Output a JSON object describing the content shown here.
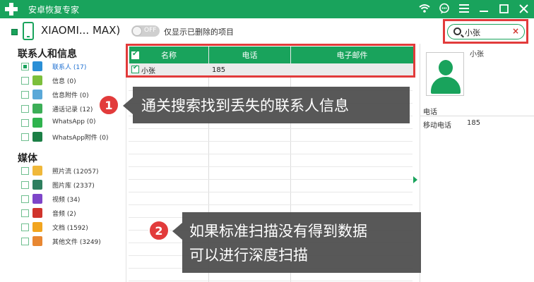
{
  "app": {
    "title": "安卓恢复专家",
    "brand_color": "#19a35c",
    "highlight_color": "#e23b3b"
  },
  "titlebar_icons": [
    "wifi-icon",
    "chat-icon",
    "menu-icon",
    "minimize-icon",
    "maximize-icon",
    "close-icon"
  ],
  "device": {
    "name": "XIAOMI... MAX)",
    "toggle_label": "OFF",
    "filter_label": "仅显示已删除的项目"
  },
  "search": {
    "value": "小张",
    "clear_glyph": "×"
  },
  "sidebar": {
    "contacts_title": "联系人和信息",
    "media_title": "媒体",
    "contact_items": [
      {
        "label": "联系人 (17)",
        "icon": "contacts-icon",
        "color": "#2b8fd6",
        "checked": true
      },
      {
        "label": "信息 (0)",
        "icon": "message-icon",
        "color": "#7cbf3c",
        "checked": false
      },
      {
        "label": "信息附件 (0)",
        "icon": "attachment-icon",
        "color": "#5aa8d8",
        "checked": false
      },
      {
        "label": "通话记录 (12)",
        "icon": "call-log-icon",
        "color": "#3cae57",
        "checked": false
      },
      {
        "label": "WhatsApp (0)",
        "icon": "whatsapp-icon",
        "color": "#2fb34e",
        "checked": false
      },
      {
        "label": "WhatsApp附件 (0)",
        "icon": "whatsapp-attachment-icon",
        "color": "#1c7f46",
        "checked": false
      }
    ],
    "media_items": [
      {
        "label": "照片流 (12057)",
        "icon": "photo-stream-icon",
        "color": "#f0b83a",
        "checked": false
      },
      {
        "label": "图片库 (2337)",
        "icon": "gallery-icon",
        "color": "#2e7f5f",
        "checked": false
      },
      {
        "label": "视频 (34)",
        "icon": "video-icon",
        "color": "#7e45c9",
        "checked": false
      },
      {
        "label": "音频 (2)",
        "icon": "audio-icon",
        "color": "#d0342c",
        "checked": false
      },
      {
        "label": "文档 (1592)",
        "icon": "document-icon",
        "color": "#f2a51f",
        "checked": false
      },
      {
        "label": "其他文件 (3249)",
        "icon": "other-files-icon",
        "color": "#e88732",
        "checked": false
      }
    ]
  },
  "table": {
    "columns": [
      "名称",
      "电话",
      "电子邮件"
    ],
    "rows": [
      {
        "name": "小张",
        "phone": "185",
        "email": ""
      }
    ]
  },
  "detail": {
    "name": "小张",
    "section": "电话",
    "type": "移动电话",
    "number": "185"
  },
  "callouts": [
    {
      "num": "1",
      "line1": "通关搜索找到丢失的联系人信息",
      "line2": ""
    },
    {
      "num": "2",
      "line1": "如果标准扫描没有得到数据",
      "line2": "可以进行深度扫描"
    }
  ]
}
